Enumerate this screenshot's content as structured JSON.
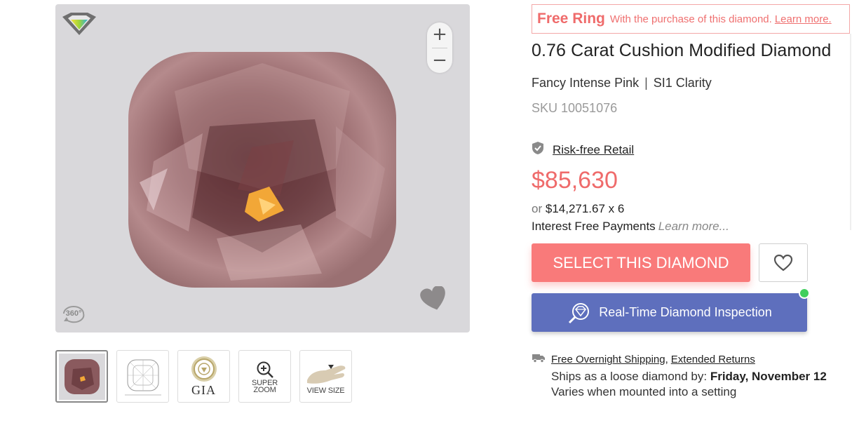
{
  "viewer": {
    "zoom_in": "+",
    "zoom_out": "−",
    "label_360": "360°"
  },
  "thumbnails": {
    "gia": "GIA",
    "super_zoom": "SUPER ZOOM",
    "view_size": "VIEW SIZE"
  },
  "promo": {
    "title": "Free Ring",
    "text": "With the purchase of this diamond.",
    "link": "Learn more."
  },
  "product": {
    "title": "0.76 Carat Cushion Modified Diamond",
    "color": "Fancy Intense Pink",
    "separator": "|",
    "clarity": "SI1 Clarity",
    "sku": "SKU 10051076",
    "risk_free": "Risk-free Retail",
    "price": "$85,630",
    "installment_or": "or",
    "installment_amount": "$14,271.67 x 6",
    "interest_text": "Interest Free Payments",
    "interest_learn": "Learn more..."
  },
  "actions": {
    "select": "SELECT THIS DIAMOND",
    "inspection": "Real-Time Diamond Inspection"
  },
  "shipping": {
    "free_overnight": "Free Overnight Shipping",
    "comma": ",",
    "extended_returns": "Extended Returns",
    "ships_prefix": "Ships as a loose diamond by:",
    "ships_date": "Friday, November 12",
    "varies": "Varies when mounted into a setting"
  },
  "colors": {
    "accent": "#f97a7a",
    "price": "#ef6b6b",
    "inspection_bg": "#5e6fbd",
    "live_indicator": "#3fcf5c"
  }
}
